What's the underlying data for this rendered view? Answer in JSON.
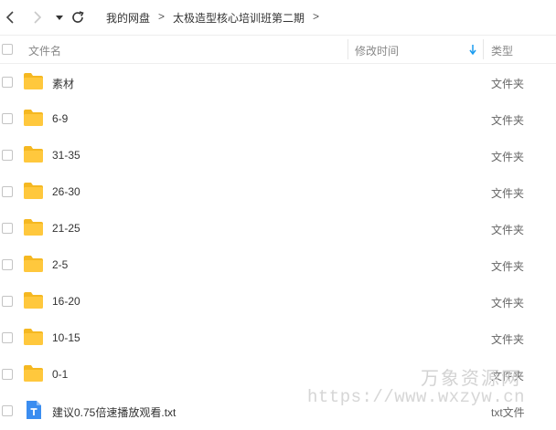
{
  "toolbar": {
    "breadcrumb": [
      "我的网盘",
      "太极造型核心培训班第二期"
    ],
    "separator": ">"
  },
  "columns": {
    "name": "文件名",
    "modified": "修改时间",
    "type": "类型"
  },
  "files": [
    {
      "name": "素材",
      "type": "文件夹",
      "icon": "folder-icon"
    },
    {
      "name": "6-9",
      "type": "文件夹",
      "icon": "folder-icon"
    },
    {
      "name": "31-35",
      "type": "文件夹",
      "icon": "folder-icon"
    },
    {
      "name": "26-30",
      "type": "文件夹",
      "icon": "folder-icon"
    },
    {
      "name": "21-25",
      "type": "文件夹",
      "icon": "folder-icon"
    },
    {
      "name": "2-5",
      "type": "文件夹",
      "icon": "folder-icon"
    },
    {
      "name": "16-20",
      "type": "文件夹",
      "icon": "folder-icon"
    },
    {
      "name": "10-15",
      "type": "文件夹",
      "icon": "folder-icon"
    },
    {
      "name": "0-1",
      "type": "文件夹",
      "icon": "folder-icon"
    },
    {
      "name": "建议0.75倍速播放观看.txt",
      "type": "txt文件",
      "icon": "text-file-icon"
    }
  ],
  "watermark": {
    "title": "万象资源网",
    "url": "https://www.wxzyw.cn"
  },
  "colors": {
    "folder": "#ffc83d",
    "folder_tab": "#f5b821",
    "text_file": "#3b8df0",
    "sort_arrow": "#1a9cf0"
  }
}
